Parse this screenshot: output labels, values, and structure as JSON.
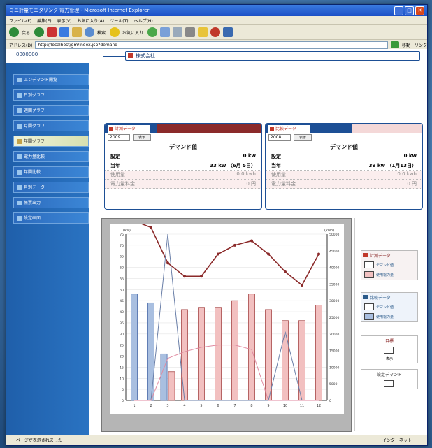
{
  "window": {
    "title": "ミニ計量モニタリング 電力管理 - Microsoft Internet Explorer",
    "menu": [
      "ファイル(F)",
      "編集(E)",
      "表示(V)",
      "お気に入り(A)",
      "ツール(T)",
      "ヘルプ(H)"
    ],
    "toolbar": {
      "back": "戻る",
      "search": "検索",
      "favorites": "お気に入り"
    },
    "address_label": "アドレス(D)",
    "address_value": "http://localhost/gm/index.jsp?demand",
    "go_label": "移動",
    "links_label": "リンク"
  },
  "header": {
    "code": "0000000",
    "company": "株式会社"
  },
  "sidebar": {
    "items": [
      {
        "label": "エンデマンド閲覧"
      },
      {
        "label": "日別グラフ"
      },
      {
        "label": "週間グラフ"
      },
      {
        "label": "月間グラフ"
      },
      {
        "label": "年間グラフ"
      },
      {
        "label": "電力量比較"
      },
      {
        "label": "年間比較"
      },
      {
        "label": "月別データ"
      },
      {
        "label": "帳票出力"
      },
      {
        "label": "設定画面"
      }
    ],
    "active_index": 4
  },
  "panel_current": {
    "tab": "計測データ",
    "year": "2009",
    "btn": "表示",
    "title": "デマンド値",
    "rows": [
      {
        "label": "設定",
        "value": "0 kw"
      },
      {
        "label": "当年",
        "value": "33 kw （6月 5日）"
      },
      {
        "label": "使用量",
        "value": "0.0 kwh"
      },
      {
        "label": "電力量料金",
        "value": "0 円"
      }
    ]
  },
  "panel_compare": {
    "tab": "比較データ",
    "year": "2008",
    "btn": "表示",
    "title": "デマンド値",
    "rows": [
      {
        "label": "設定",
        "value": "0 kw"
      },
      {
        "label": "当年",
        "value": "39 kw （1月13日）"
      },
      {
        "label": "使用量",
        "value": "0.0 kwh"
      },
      {
        "label": "電力量料金",
        "value": "0 円"
      }
    ]
  },
  "chart_data": {
    "type": "bar",
    "categories": [
      "1",
      "2",
      "3",
      "4",
      "5",
      "6",
      "7",
      "8",
      "9",
      "10",
      "11",
      "12"
    ],
    "ylabel": "(kw)",
    "y2label": "(kwh)",
    "ylim": [
      0,
      75
    ],
    "y2lim": [
      0,
      50000
    ],
    "series": [
      {
        "name": "",
        "kind": "bar",
        "axis": "left",
        "values": [
          48,
          44,
          21,
          0,
          0,
          0,
          0,
          0,
          0,
          0,
          0,
          0
        ],
        "color": "#a9bfe0"
      },
      {
        "name": "",
        "kind": "bar",
        "axis": "left",
        "values": [
          0,
          0,
          13,
          41,
          42,
          42,
          45,
          48,
          41,
          36,
          36,
          43
        ],
        "color": "#f2c0c0"
      },
      {
        "name": "",
        "kind": "line",
        "axis": "left",
        "values": [
          81,
          78,
          62,
          56,
          56,
          66,
          70,
          72,
          66,
          58,
          52,
          66
        ],
        "color": "#8b2a2a"
      },
      {
        "name": "",
        "kind": "line",
        "axis": "left",
        "values": [
          0,
          0,
          75,
          0,
          0,
          0,
          0,
          0,
          0,
          31,
          0,
          0
        ],
        "color": "#6a7fa8"
      },
      {
        "name": "",
        "kind": "line",
        "axis": "left",
        "values": [
          0,
          0,
          19,
          22,
          24,
          25,
          25,
          23,
          0,
          0,
          0,
          0
        ],
        "color": "#e08aa0"
      }
    ]
  },
  "legend": {
    "current_title": "計測データ",
    "current_items": [
      "デマンド値",
      "使用電力量"
    ],
    "compare_title": "比較データ",
    "compare_items": [
      "デマンド値",
      "使用電力量"
    ],
    "target_title": "目標",
    "setting_title": "設定デマンド",
    "show_label": "表示"
  },
  "status": {
    "left": "ページが表示されました",
    "right": "インターネット"
  }
}
